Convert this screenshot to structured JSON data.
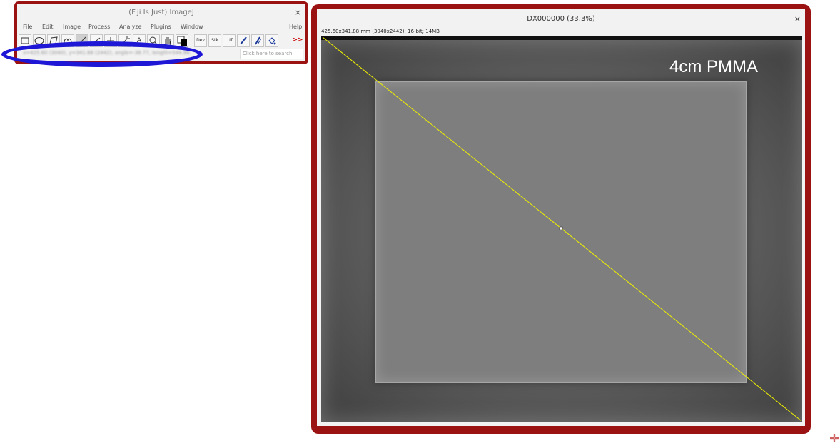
{
  "imagej_window": {
    "title": "(Fiji Is Just) ImageJ",
    "close": "×",
    "menus": [
      "File",
      "Edit",
      "Image",
      "Process",
      "Analyze",
      "Plugins",
      "Window",
      "Help"
    ],
    "tools": {
      "rect": "",
      "oval": "",
      "poly": "",
      "free": "",
      "line": "",
      "angle": "",
      "point": "",
      "wand": "",
      "text": "A",
      "zoom": "",
      "hand": "",
      "color": "",
      "dev": "Dev",
      "stk": "Stk",
      "lut": "LUT",
      "more": ">>"
    },
    "status_text": "x=425.60 (3040), y=341.88 (2442), angle=-38.77, length=544.88",
    "search_placeholder": "Click here to search"
  },
  "image_window": {
    "title": "DX000000 (33.3%)",
    "close": "×",
    "info": "425.60x341.88 mm (3040x2442); 16-bit; 14MB",
    "overlay_label": "4cm PMMA"
  },
  "colors": {
    "window_frame": "#9b1212",
    "annotation_ellipse": "#1f17d6",
    "line_roi": "#f0f000"
  }
}
